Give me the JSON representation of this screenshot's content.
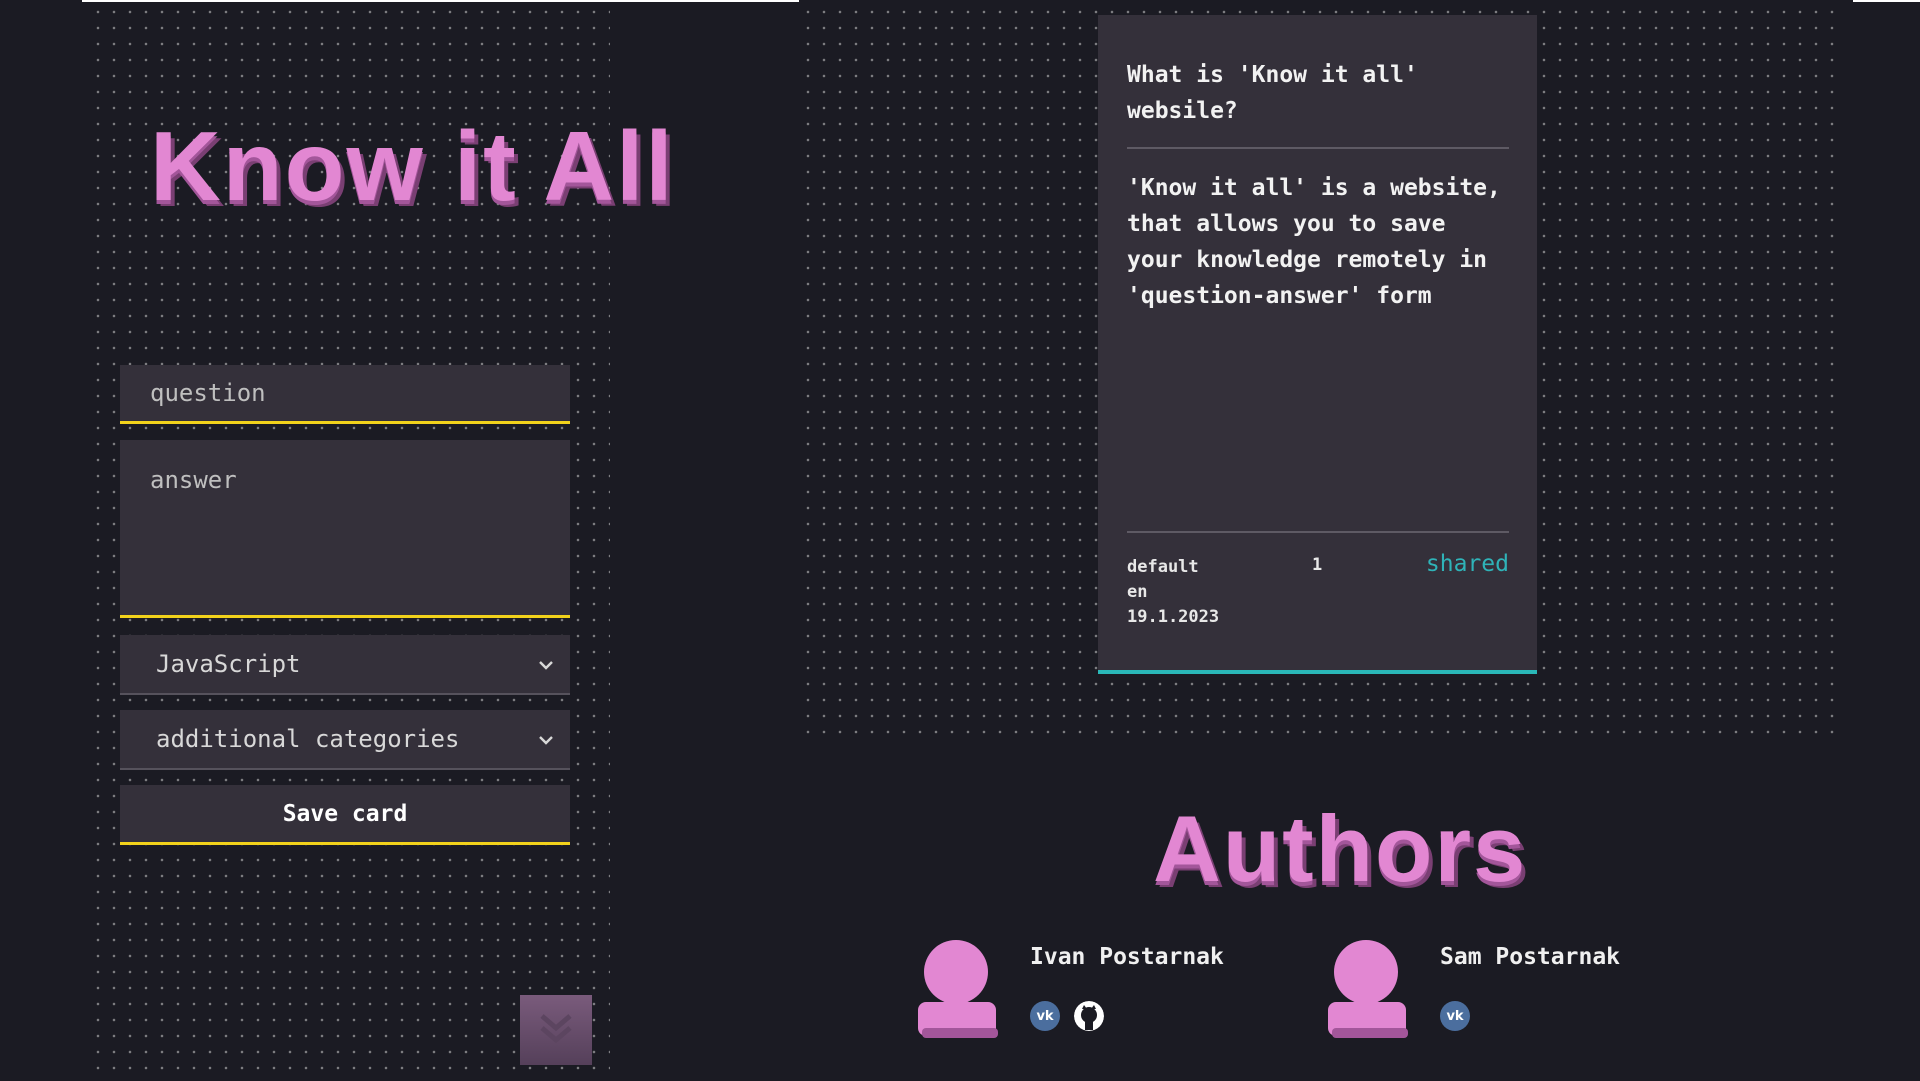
{
  "app": {
    "logo_text": "Know it All"
  },
  "form": {
    "question_placeholder": "question",
    "answer_placeholder": "answer",
    "language_select": "JavaScript",
    "categories_select": "additional categories",
    "save_label": "Save card"
  },
  "card": {
    "question": "What is 'Know it all' websile?",
    "answer": "'Know it all' is a website, that allows you to save your knowledge remotely in 'question-answer' form",
    "category": "default",
    "language": "en",
    "date": "19.1.2023",
    "count": "1",
    "status": "shared"
  },
  "authors": {
    "title": "Authors",
    "list": [
      {
        "name": "Ivan Postarnak",
        "social": [
          "vk-icon",
          "github-icon"
        ]
      },
      {
        "name": "Sam Postarnak",
        "social": [
          "vk-icon"
        ]
      }
    ]
  },
  "colors": {
    "background": "#1b1b23",
    "panel": "#34303a",
    "accent_yellow": "#f2d21b",
    "accent_teal": "#2ab8b8",
    "logo_pink": "#e287d2"
  }
}
